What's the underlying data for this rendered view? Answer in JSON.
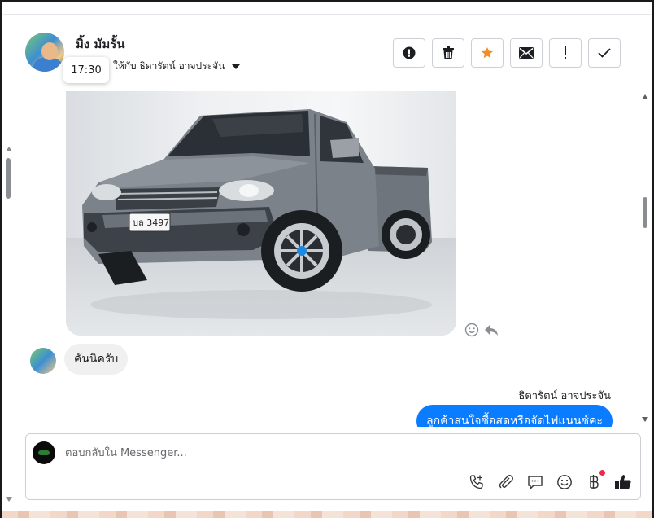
{
  "header": {
    "user_name": "มิ้ง มัมรั้น",
    "assigned_text": "ให้กับ ธิดารัตน์ อาจประจัน",
    "timestamp_tooltip": "17:30",
    "actions": [
      {
        "name": "report-button",
        "icon": "exclamation-circle-icon"
      },
      {
        "name": "delete-button",
        "icon": "trash-icon"
      },
      {
        "name": "star-button",
        "icon": "star-icon"
      },
      {
        "name": "mark-unread-button",
        "icon": "envelope-icon"
      },
      {
        "name": "follow-up-button",
        "icon": "exclamation-icon"
      },
      {
        "name": "done-button",
        "icon": "check-icon"
      }
    ]
  },
  "messages": [
    {
      "type": "image",
      "description": "car-photo",
      "direction": "incoming"
    },
    {
      "type": "text",
      "direction": "incoming",
      "text": "คันนิครับ"
    },
    {
      "type": "text",
      "direction": "outgoing",
      "sender": "ธิดารัตน์ อาจประจัน",
      "text": "ลูกค้าสนใจซื้อสดหรือจัดไฟแนนซ์คะ"
    }
  ],
  "composer": {
    "placeholder": "ตอบกลับใน Messenger..."
  },
  "colors": {
    "accent": "#0a7cff",
    "star": "#f28c28",
    "notification_dot": "#f02849"
  }
}
